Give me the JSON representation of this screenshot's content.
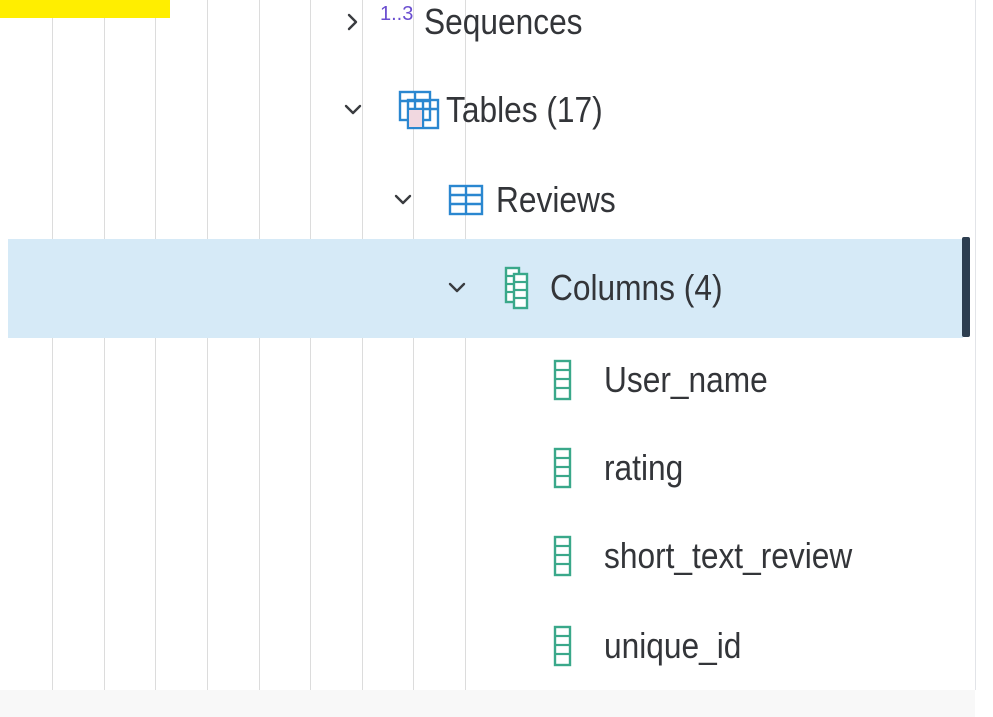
{
  "tree": {
    "sequences": {
      "label": "Sequences",
      "icon": "sequences-icon",
      "badge": "1..3",
      "expanded": false
    },
    "tables": {
      "label": "Tables (17)",
      "icon": "tables-icon",
      "expanded": true
    },
    "reviews": {
      "label": "Reviews",
      "icon": "table-icon",
      "expanded": true
    },
    "columns": {
      "label": "Columns (4)",
      "icon": "columns-icon",
      "expanded": true,
      "selected": true
    },
    "column_items": [
      {
        "label": "User_name",
        "icon": "column-icon"
      },
      {
        "label": "rating",
        "icon": "column-icon"
      },
      {
        "label": "short_text_review",
        "icon": "column-icon"
      },
      {
        "label": "unique_id",
        "icon": "column-icon"
      }
    ]
  },
  "colors": {
    "selection": "#d6eaf7",
    "selection_edge": "#2d3e50",
    "table_icon": "#2a87d0",
    "column_icon": "#3aa88a",
    "sequence_glyph": "#6a4ed0",
    "text": "#333539",
    "badge": "#ffee00"
  }
}
